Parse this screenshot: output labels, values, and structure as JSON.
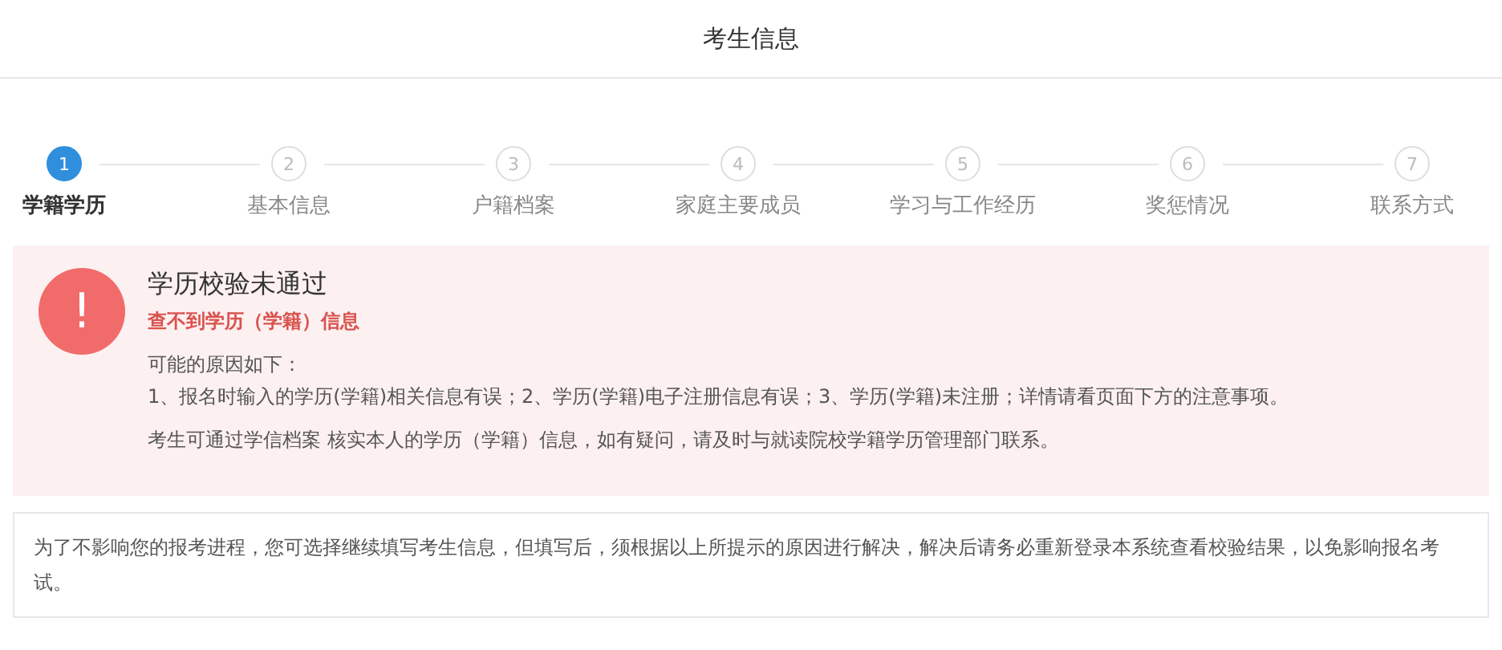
{
  "header": {
    "title": "考生信息"
  },
  "steps": [
    {
      "number": "1",
      "label": "学籍学历",
      "selected": true
    },
    {
      "number": "2",
      "label": "基本信息",
      "selected": false
    },
    {
      "number": "3",
      "label": "户籍档案",
      "selected": false
    },
    {
      "number": "4",
      "label": "家庭主要成员",
      "selected": false
    },
    {
      "number": "5",
      "label": "学习与工作经历",
      "selected": false
    },
    {
      "number": "6",
      "label": "奖惩情况",
      "selected": false
    },
    {
      "number": "7",
      "label": "联系方式",
      "selected": false
    }
  ],
  "alert": {
    "icon_text": "!",
    "title": "学历校验未通过",
    "subtitle": "查不到学历（学籍）信息",
    "reasons_heading": "可能的原因如下：",
    "reasons": "1、报名时输入的学历(学籍)相关信息有误；2、学历(学籍)电子注册信息有误；3、学历(学籍)未注册；详情请看页面下方的注意事项。",
    "advice": "考生可通过学信档案 核实本人的学历（学籍）信息，如有疑问，请及时与就读院校学籍学历管理部门联系。"
  },
  "notice": {
    "text": "为了不影响您的报考进程，您可选择继续填写考生信息，但填写后，须根据以上所提示的原因进行解决，解决后请务必重新登录本系统查看校验结果，以免影响报名考试。"
  }
}
